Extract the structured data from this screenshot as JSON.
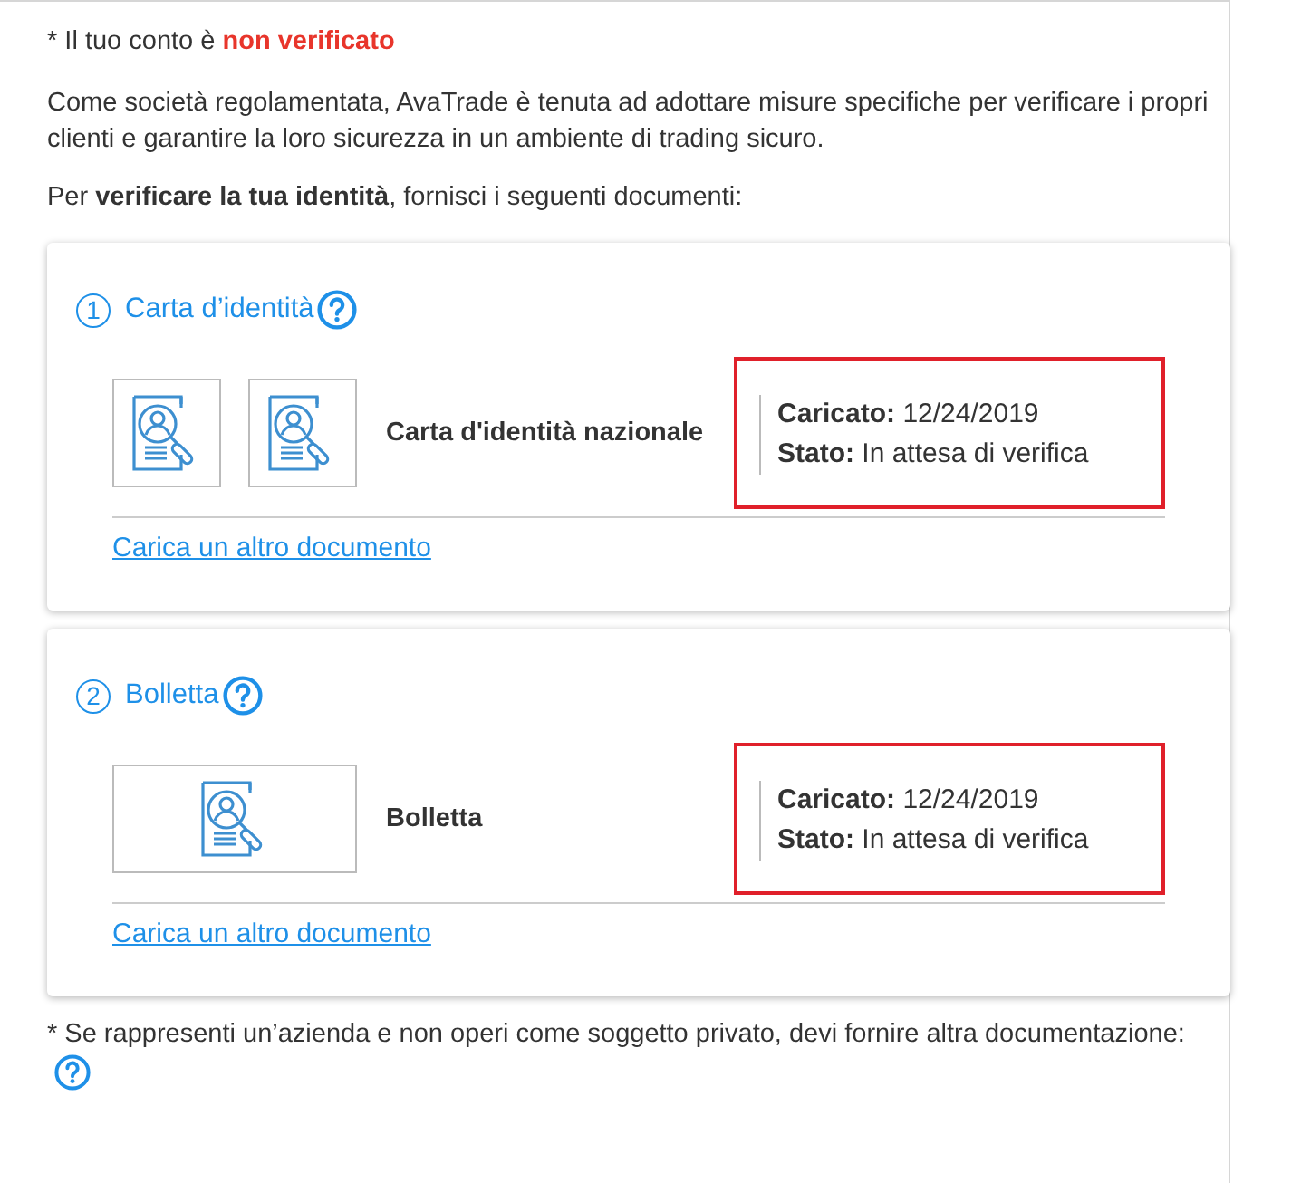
{
  "account_notice": "* Il tuo conto è **non verificato**",
  "intro": "Come società regolamentata, AvaTrade è tenuta ad adottare misure specifiche per verificare i propri clienti e garantire la loro sicurezza in un ambiente di trading sicuro.",
  "request": "Per **verificare la tua identità**, fornisci i seguenti documenti:",
  "documents": [
    {
      "number": "1",
      "title": "Carta d’identità",
      "thumbnails": [
        {
          "kind": "square"
        },
        {
          "kind": "square"
        }
      ],
      "name": "Carta d'identità nazionale",
      "uploaded": "**Caricato:** 12/24/2019",
      "status": "**Stato:** In attesa di verifica",
      "highlighted": true,
      "link": "Carica un altro documento"
    },
    {
      "number": "2",
      "title": "Bolletta",
      "thumbnails": [
        {
          "kind": "wide"
        }
      ],
      "name": "Bolletta",
      "uploaded": "**Caricato:** 12/24/2019",
      "status": "**Stato:** In attesa di verifica",
      "highlighted": true,
      "link": "Carica un altro documento"
    }
  ],
  "footnote": "* Se rappresenti un’azienda e non operi come soggetto privato, devi fornire altra documentazione:"
}
